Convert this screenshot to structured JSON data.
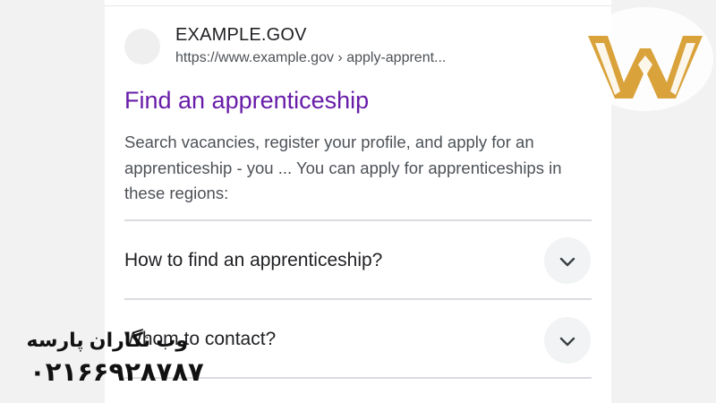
{
  "result": {
    "site_name": "EXAMPLE.GOV",
    "url": "https://www.example.gov › apply-apprent...",
    "title": "Find an apprenticeship",
    "snippet": "Search vacancies, register your profile, and apply for an apprenticeship - you ... You can apply for apprenticeships in these regions:"
  },
  "faq": [
    {
      "question": "How to find an apprenticeship?",
      "icon": "chevron-down-icon"
    },
    {
      "question": "Whom to contact?",
      "icon": "chevron-down-icon"
    }
  ],
  "watermark": {
    "name": "وب نگاران پارسه",
    "phone": "۰۲۱۶۶۹۲۸۷۸۷",
    "logo_color": "#d9a23a"
  },
  "colors": {
    "title_link": "#681da8",
    "snippet_text": "#4d5156",
    "divider": "#dadce0"
  }
}
